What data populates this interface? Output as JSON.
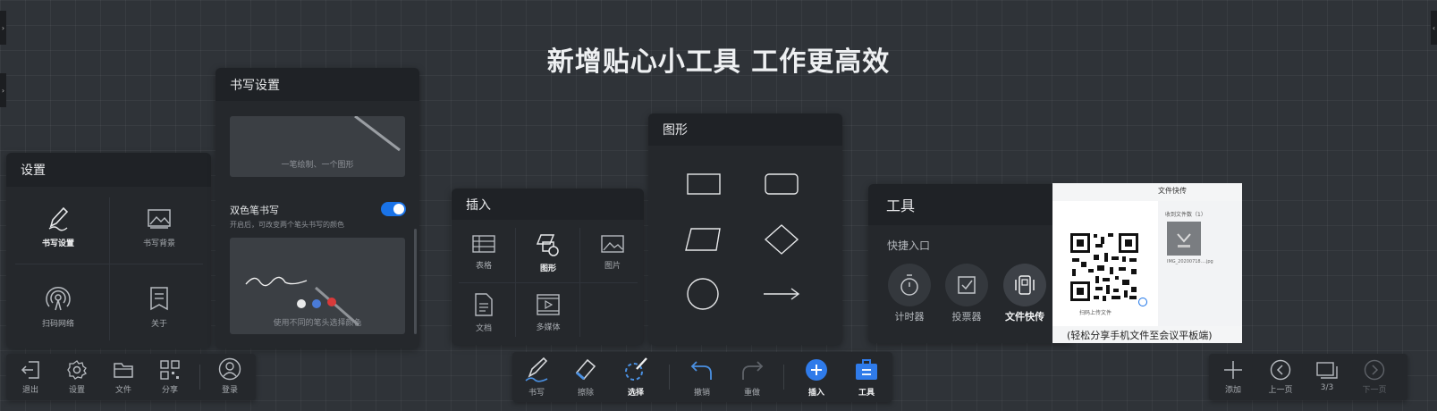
{
  "headline": "新增贴心小工具  工作更高效",
  "colors": {
    "accent": "#1a73e8",
    "toggle_on": "#1a73e8",
    "background": "#2f3338",
    "panel": "#25282c"
  },
  "settings_panel": {
    "title": "设置",
    "items": [
      {
        "label": "书写设置",
        "icon": "pen-icon",
        "active": true
      },
      {
        "label": "书写背景",
        "icon": "image-icon",
        "active": false
      },
      {
        "label": "扫码网络",
        "icon": "signal-icon",
        "active": false
      },
      {
        "label": "关于",
        "icon": "bookmark-icon",
        "active": false
      }
    ]
  },
  "writing_panel": {
    "title": "书写设置",
    "preview1_caption": "一笔绘制、一个图形",
    "dual_pen": {
      "title": "双色笔书写",
      "subtitle": "开启后，可改变两个笔头书写的颜色",
      "enabled": true
    },
    "preview2_caption": "使用不同的笔头选择颜色"
  },
  "insert_panel": {
    "title": "插入",
    "items": [
      {
        "label": "表格",
        "icon": "table-icon"
      },
      {
        "label": "图形",
        "icon": "shapes-icon",
        "active": true
      },
      {
        "label": "图片",
        "icon": "picture-icon"
      },
      {
        "label": "文档",
        "icon": "document-icon"
      },
      {
        "label": "多媒体",
        "icon": "media-icon"
      }
    ]
  },
  "shapes_panel": {
    "title": "图形",
    "shapes": [
      "rectangle",
      "rounded-rectangle",
      "parallelogram",
      "diamond",
      "circle",
      "arrow"
    ]
  },
  "tools_panel": {
    "title": "工具",
    "subtitle": "快捷入口",
    "items": [
      {
        "label": "计时器",
        "icon": "timer-icon"
      },
      {
        "label": "投票器",
        "icon": "vote-icon"
      },
      {
        "label": "文件快传",
        "icon": "file-transfer-icon",
        "active": true
      }
    ]
  },
  "file_transfer_popup": {
    "title": "文件快传",
    "received_label": "收到文件数（1）",
    "file_name": "IMG_20200718....jpg",
    "scan_caption": "扫码上传文件",
    "footer_caption": "(轻松分享手机文件至会议平板端)"
  },
  "bottom_left_bar": {
    "items": [
      {
        "label": "退出",
        "icon": "exit-icon"
      },
      {
        "label": "设置",
        "icon": "gear-icon"
      },
      {
        "label": "文件",
        "icon": "folder-icon"
      },
      {
        "label": "分享",
        "icon": "qr-grid-icon"
      },
      {
        "label": "登录",
        "icon": "user-icon"
      }
    ]
  },
  "bottom_center_bar": {
    "items": [
      {
        "label": "书写",
        "icon": "pen-icon"
      },
      {
        "label": "擦除",
        "icon": "eraser-icon"
      },
      {
        "label": "选择",
        "icon": "lasso-icon",
        "active": true
      },
      {
        "label": "撤销",
        "icon": "undo-icon"
      },
      {
        "label": "重做",
        "icon": "redo-icon"
      },
      {
        "label": "插入",
        "icon": "plus-circle-icon",
        "active": true
      },
      {
        "label": "工具",
        "icon": "toolbox-icon",
        "active": true
      }
    ]
  },
  "bottom_right_bar": {
    "items": [
      {
        "label": "添加",
        "icon": "plus-icon"
      },
      {
        "label": "上一页",
        "icon": "prev-page-icon"
      },
      {
        "label": "3/3",
        "icon": "pages-icon"
      },
      {
        "label": "下一页",
        "icon": "next-page-icon",
        "disabled": true
      }
    ]
  }
}
